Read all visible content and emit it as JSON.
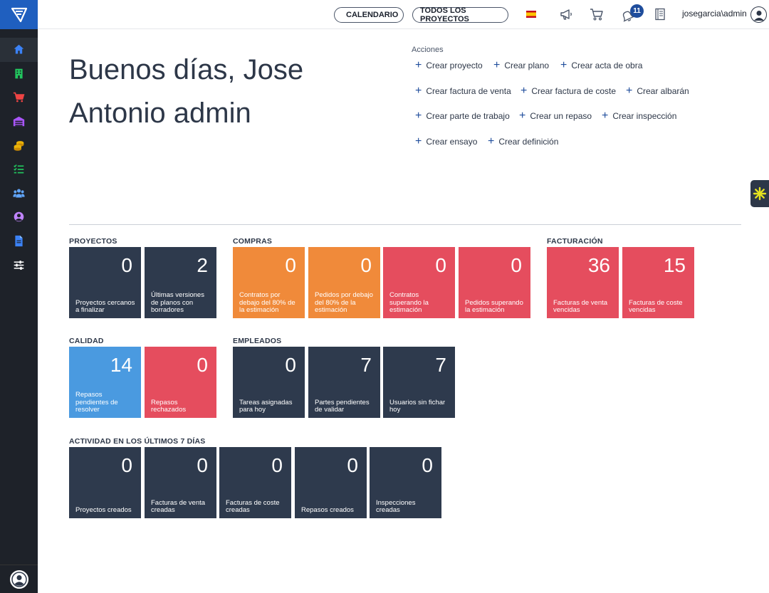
{
  "topbar": {
    "calendar_label": "CALENDARIO",
    "projects_label": "TODOS LOS PROYECTOS",
    "notification_count": "11",
    "username": "josegarcia\\admin"
  },
  "greeting": "Buenos días, Jose Antonio admin",
  "actions": {
    "title": "Acciones",
    "items": [
      "Crear proyecto",
      "Crear plano",
      "Crear acta de obra",
      "Crear factura de venta",
      "Crear factura de coste",
      "Crear albarán",
      "Crear parte de trabajo",
      "Crear un repaso",
      "Crear inspección",
      "Crear ensayo",
      "Crear definición"
    ]
  },
  "sections": {
    "proyectos": {
      "title": "PROYECTOS",
      "tiles": [
        {
          "value": "0",
          "label": "Proyectos cercanos a finalizar"
        },
        {
          "value": "2",
          "label": "Últimas versiones de planos con borradores"
        }
      ]
    },
    "compras": {
      "title": "COMPRAS",
      "tiles": [
        {
          "value": "0",
          "label": "Contratos por debajo del 80% de la estimación"
        },
        {
          "value": "0",
          "label": "Pedidos por debajo del 80% de la estimación"
        },
        {
          "value": "0",
          "label": "Contratos superando la estimación"
        },
        {
          "value": "0",
          "label": "Pedidos superando la estimación"
        }
      ]
    },
    "facturacion": {
      "title": "FACTURACIÓN",
      "tiles": [
        {
          "value": "36",
          "label": "Facturas de venta vencidas"
        },
        {
          "value": "15",
          "label": "Facturas de coste vencidas"
        }
      ]
    },
    "calidad": {
      "title": "CALIDAD",
      "tiles": [
        {
          "value": "14",
          "label": "Repasos pendientes de resolver"
        },
        {
          "value": "0",
          "label": "Repasos rechazados"
        }
      ]
    },
    "empleados": {
      "title": "EMPLEADOS",
      "tiles": [
        {
          "value": "0",
          "label": "Tareas asignadas para hoy"
        },
        {
          "value": "7",
          "label": "Partes pendientes de validar"
        },
        {
          "value": "7",
          "label": "Usuarios sin fichar hoy"
        }
      ]
    },
    "actividad": {
      "title": "ACTIVIDAD EN LOS ÚLTIMOS 7 DÍAS",
      "tiles": [
        {
          "value": "0",
          "label": "Proyectos creados"
        },
        {
          "value": "0",
          "label": "Facturas de venta creadas"
        },
        {
          "value": "0",
          "label": "Facturas de coste creadas"
        },
        {
          "value": "0",
          "label": "Repasos creados"
        },
        {
          "value": "0",
          "label": "Inspecciones creadas"
        }
      ]
    }
  },
  "colors": {
    "dark_tile": "#2e3a4d",
    "orange_tile": "#f08a3a",
    "red_tile": "#e54d5e",
    "blue_tile": "#4a9ae0",
    "sidebar": "#1e2229",
    "brand": "#1f5fbf"
  },
  "sidebar_icons": [
    "home-icon",
    "building-icon",
    "cart-icon",
    "warehouse-icon",
    "coins-icon",
    "checklist-icon",
    "users-icon",
    "user-circle-icon",
    "document-icon",
    "sliders-icon"
  ]
}
